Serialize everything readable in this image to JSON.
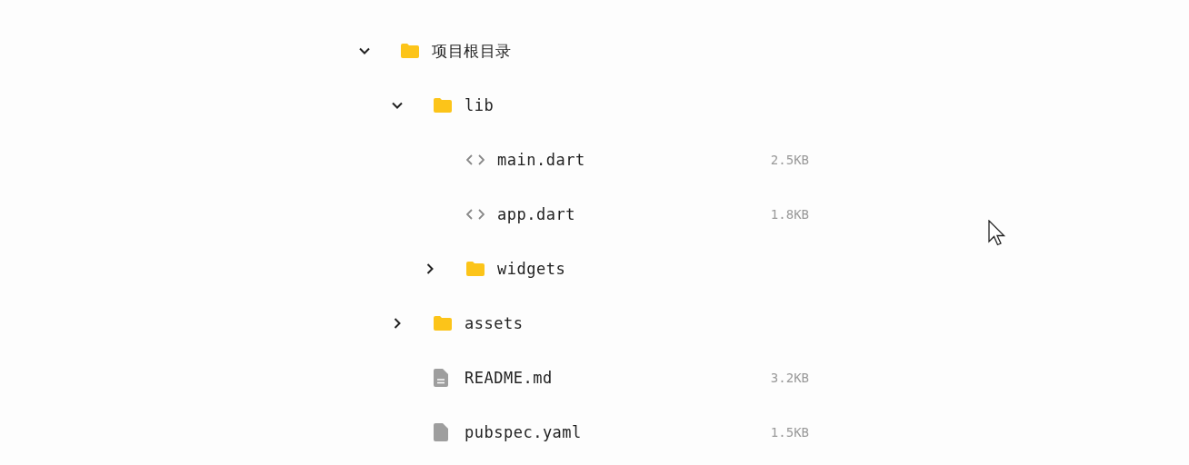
{
  "tree": [
    {
      "kind": "folder",
      "name": "项目根目录",
      "expanded": true,
      "children": [
        {
          "kind": "folder",
          "name": "lib",
          "expanded": true,
          "children": [
            {
              "kind": "code",
              "name": "main.dart",
              "size": "2.5KB"
            },
            {
              "kind": "code",
              "name": "app.dart",
              "size": "1.8KB"
            },
            {
              "kind": "folder",
              "name": "widgets",
              "expanded": false
            }
          ]
        },
        {
          "kind": "folder",
          "name": "assets",
          "expanded": false
        },
        {
          "kind": "doc",
          "name": "README.md",
          "size": "3.2KB"
        },
        {
          "kind": "file",
          "name": "pubspec.yaml",
          "size": "1.5KB"
        }
      ]
    }
  ]
}
